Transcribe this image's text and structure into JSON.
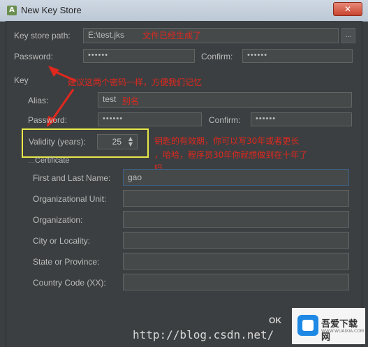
{
  "window": {
    "title": "New Key Store",
    "close_label": "✕"
  },
  "keystore": {
    "path_label": "Key store path:",
    "path_value": "E:\\test.jks",
    "browse_label": "...",
    "password_label": "Password:",
    "password_value": "••••••",
    "confirm_label": "Confirm:",
    "confirm_value": "••••••"
  },
  "key": {
    "section_label": "Key",
    "alias_label": "Alias:",
    "alias_value": "test",
    "password_label": "Password:",
    "password_value": "••••••",
    "confirm_label": "Confirm:",
    "confirm_value": "••••••",
    "validity_label": "Validity (years):",
    "validity_value": "25"
  },
  "certificate": {
    "title": "Certificate",
    "first_last_label": "First and Last Name:",
    "first_last_value": "gao",
    "org_unit_label": "Organizational Unit:",
    "org_label": "Organization:",
    "city_label": "City or Locality:",
    "state_label": "State or Province:",
    "country_label": "Country Code (XX):"
  },
  "annotations": {
    "path_note": "文件已经生成了",
    "password_note": "建议这两个密码一样，方便我们记忆",
    "alias_note": "别名",
    "validity_note_1": "钥匙的有效期，你可以写30年或者更长",
    "validity_note_2": "，哈哈，程序员30年你就想做到在十年了",
    "validity_note_3": "吗"
  },
  "footer": {
    "ok_label": "OK",
    "watermark": "http://blog.csdn.net/",
    "site_logo_text": "吾爱下载网",
    "site_logo_sub": "WWW.WUAIXIA.COM"
  },
  "colors": {
    "background": "#3c3f41",
    "annotation": "#e0281e",
    "highlight": "#e8e84a"
  }
}
